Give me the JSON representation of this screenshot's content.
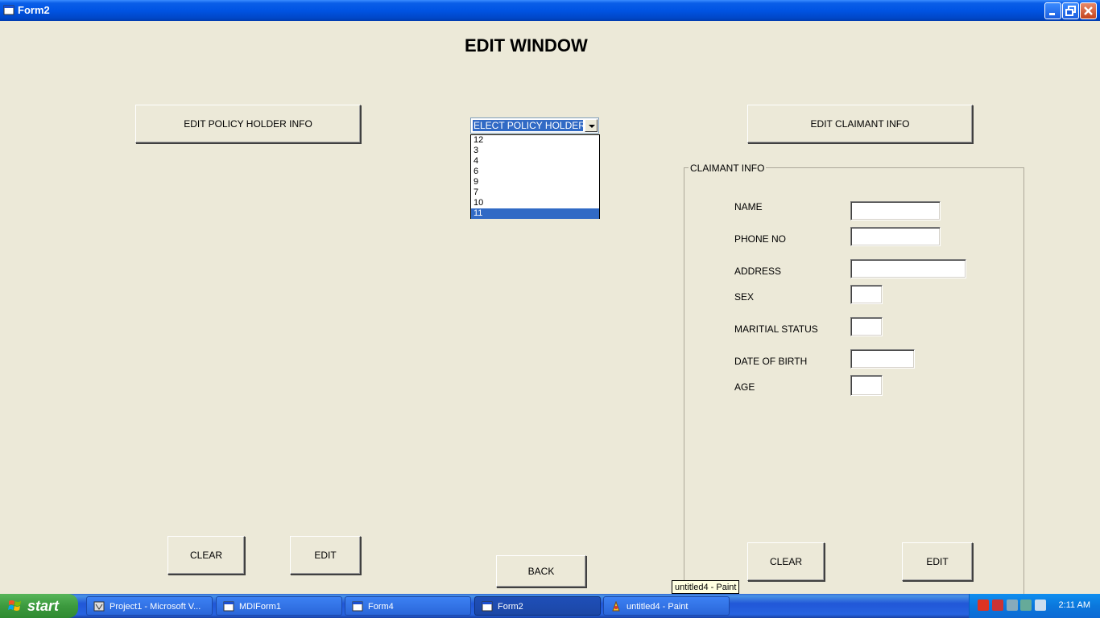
{
  "window": {
    "title": "Form2"
  },
  "form": {
    "heading": "EDIT WINDOW",
    "edit_policy_holder_btn": "EDIT POLICY HOLDER INFO",
    "edit_claimant_btn": "EDIT CLAIMANT INFO",
    "combo": {
      "value": "ELECT POLICY HOLDER ID",
      "options": [
        "12",
        "3",
        "4",
        "6",
        "9",
        "7",
        "10",
        "11"
      ],
      "selected_option": "11"
    },
    "left_clear": "CLEAR",
    "left_edit": "EDIT",
    "back": "BACK",
    "claimant": {
      "frame_label": "CLAIMANT INFO",
      "fields": [
        "NAME",
        "PHONE NO",
        "ADDRESS",
        "SEX",
        "MARITIAL STATUS",
        "DATE OF BIRTH",
        "AGE"
      ],
      "clear": "CLEAR",
      "edit": "EDIT"
    }
  },
  "taskbar": {
    "start": "start",
    "tasks": [
      "Project1 - Microsoft V...",
      "MDIForm1",
      "Form4",
      "Form2",
      "untitled4 - Paint"
    ],
    "active_task": "Form2",
    "clock": "2:11 AM",
    "tooltip": "untitled4 - Paint"
  },
  "colors": {
    "titlebar": "#0054e3",
    "face": "#ece9d8",
    "selection": "#316ac5",
    "taskbar": "#245edb",
    "start": "#3c9a3e"
  }
}
